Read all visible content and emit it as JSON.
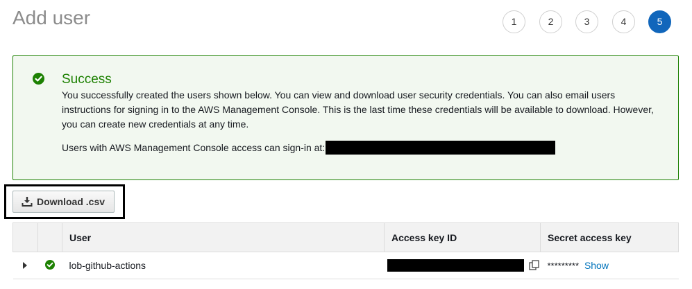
{
  "page": {
    "title": "Add user"
  },
  "wizard": {
    "steps": [
      "1",
      "2",
      "3",
      "4",
      "5"
    ],
    "active_step": "5"
  },
  "alert": {
    "title": "Success",
    "body": "You successfully created the users shown below. You can view and download user security credentials. You can also email users instructions for signing in to the AWS Management Console. This is the last time these credentials will be available to download. However, you can create new credentials at any time.",
    "signin_label": "Users with AWS Management Console access can sign-in at:",
    "icon": "check-circle-icon",
    "color": "#1d8102"
  },
  "actions": {
    "download_label": "Download .csv",
    "download_icon": "download-icon"
  },
  "table": {
    "columns": [
      "",
      "",
      "User",
      "Access key ID",
      "Secret access key"
    ],
    "rows": [
      {
        "user": "lob-github-actions",
        "secret_mask": "*********",
        "show_label": "Show"
      }
    ]
  },
  "colors": {
    "accent": "#1166bb",
    "success": "#1d8102",
    "link": "#0073bb"
  }
}
